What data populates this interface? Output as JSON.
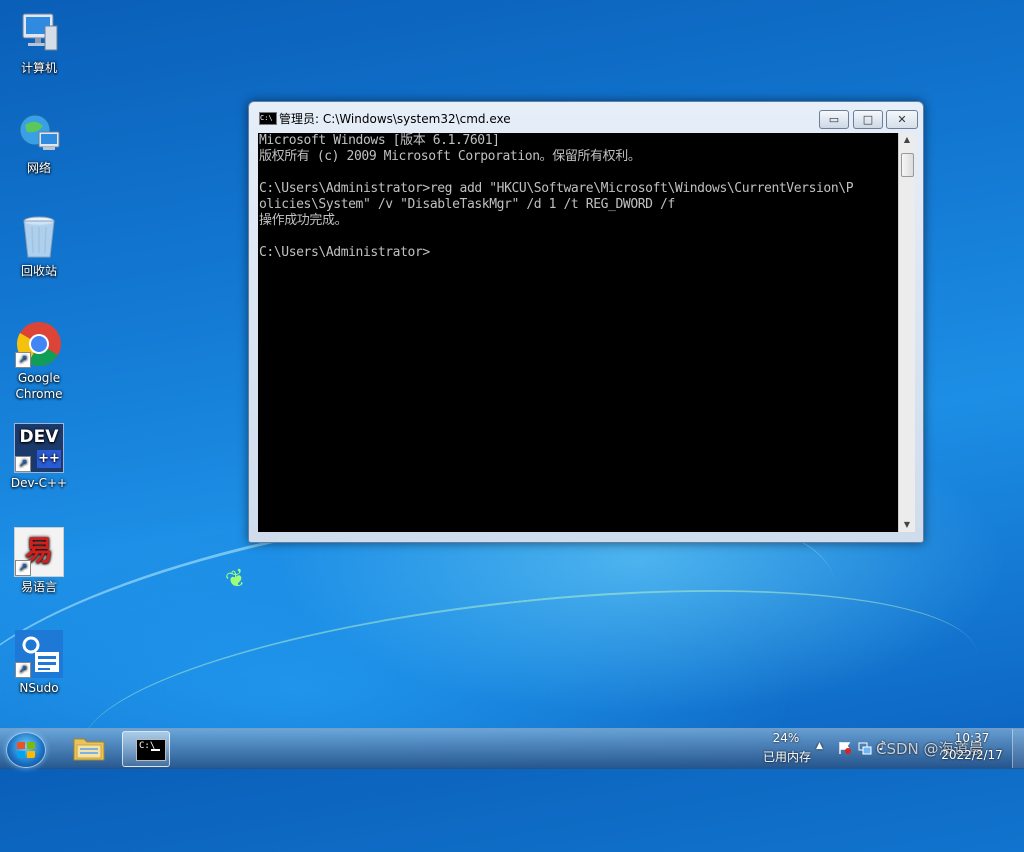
{
  "desktop": {
    "icons": [
      {
        "label": "计算机",
        "icon": "computer-icon"
      },
      {
        "label": "网络",
        "icon": "network-icon"
      },
      {
        "label": "回收站",
        "icon": "recycle-bin-icon"
      },
      {
        "label": "Google Chrome",
        "icon": "chrome-icon"
      },
      {
        "label": "Dev-C++",
        "icon": "devcpp-icon",
        "badge": "DEV"
      },
      {
        "label": "易语言",
        "icon": "yiyuyan-icon",
        "badge": "易"
      },
      {
        "label": "NSudo",
        "icon": "nsudo-icon"
      }
    ]
  },
  "window": {
    "title": "管理员: C:\\Windows\\system32\\cmd.exe",
    "icon_text": "C:\\",
    "buttons": {
      "minimize": "▭",
      "maximize": "□",
      "close": "✕"
    },
    "console_lines": [
      "Microsoft Windows [版本 6.1.7601]",
      "版权所有 (c) 2009 Microsoft Corporation。保留所有权利。",
      "",
      "C:\\Users\\Administrator>reg add \"HKCU\\Software\\Microsoft\\Windows\\CurrentVersion\\P",
      "olicies\\System\" /v \"DisableTaskMgr\" /d 1 /t REG_DWORD /f",
      "操作成功完成。",
      "",
      "C:\\Users\\Administrator>"
    ]
  },
  "taskbar": {
    "memory_percent": "24%",
    "memory_label": "已用内存",
    "clock_time": "10:37",
    "clock_date": "2022/2/17",
    "watermark": "CSDN @海道晨"
  },
  "colors": {
    "console_bg": "#000000",
    "console_fg": "#c0c0c0"
  }
}
